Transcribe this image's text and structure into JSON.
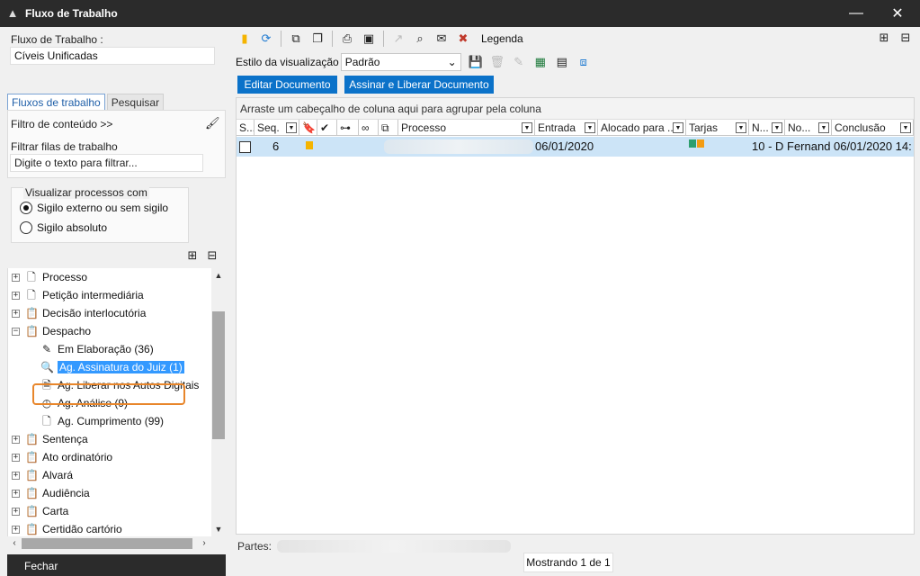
{
  "window": {
    "title": "Fluxo de Trabalho",
    "minimize": "—",
    "close": "✕"
  },
  "left": {
    "fluxo_label": "Fluxo de Trabalho :",
    "fluxo_value": "Cíveis Unificadas",
    "tabs": [
      {
        "label": "Fluxos de trabalho"
      },
      {
        "label": "Pesquisar"
      }
    ],
    "filtro_conteudo": "Filtro de conteúdo >>",
    "filtrar_label": "Filtrar filas de trabalho",
    "filtrar_placeholder": "Digite o texto para filtrar...",
    "visualizar_label": "Visualizar processos com",
    "radio_sigilo_externo": "Sigilo externo ou sem sigilo",
    "radio_sigilo_absoluto": "Sigilo absoluto",
    "tree": [
      {
        "label": "Processo"
      },
      {
        "label": "Petição intermediária"
      },
      {
        "label": "Decisão interlocutória"
      },
      {
        "label": "Despacho"
      },
      {
        "label": "Em Elaboração (36)"
      },
      {
        "label": "Ag. Assinatura do Juiz (1)"
      },
      {
        "label": "Ag. Liberar nos Autos Digitais"
      },
      {
        "label": "Ag. Análise (9)"
      },
      {
        "label": "Ag. Cumprimento (99)"
      },
      {
        "label": "Sentença"
      },
      {
        "label": "Ato ordinatório"
      },
      {
        "label": "Alvará"
      },
      {
        "label": "Audiência"
      },
      {
        "label": "Carta"
      },
      {
        "label": "Certidão cartório"
      }
    ],
    "fechar": "Fechar"
  },
  "right": {
    "legenda": "Legenda",
    "estilo_label": "Estilo da visualização",
    "estilo_value": "Padrão",
    "btn_editar": "Editar Documento",
    "btn_assinar": "Assinar e Liberar Documento",
    "group_hint": "Arraste um cabeçalho de coluna aqui para agrupar pela coluna",
    "columns": [
      "S...",
      "Seq.",
      "Processo",
      "Entrada",
      "Alocado para ...",
      "Tarjas",
      "N...",
      "No...",
      "Conclusão"
    ],
    "row": {
      "seq": "6",
      "entrada": "06/01/2020",
      "nome": "10 - D Fernand",
      "conclusao": "06/01/2020 14:"
    },
    "partes_label": "Partes:",
    "mostrando": "Mostrando 1 de 1"
  },
  "colors": {
    "accent": "#0b72c9",
    "highlight": "#e8862b",
    "selection": "#cce4f7",
    "tarja1": "#2e9e6e",
    "tarja2": "#f39c12",
    "flag": "#f5b400"
  }
}
